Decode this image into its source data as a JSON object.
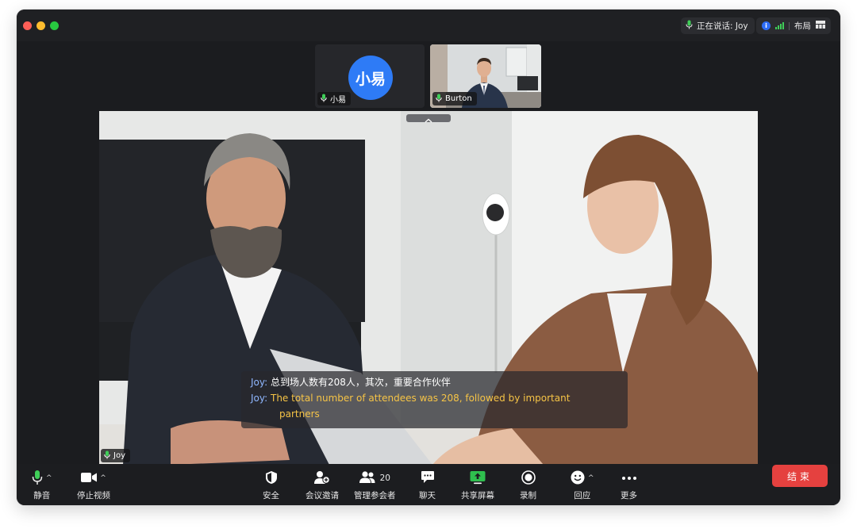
{
  "titlebar": {
    "speaking_status": "正在说话: Joy",
    "layout_label": "布局"
  },
  "thumbnails": [
    {
      "name": "小易",
      "avatar_text": "小易"
    },
    {
      "name": "Burton"
    }
  ],
  "main_video": {
    "speaker_name": "Joy"
  },
  "captions": {
    "speaker_zh": "Joy:",
    "text_zh": "总到场人数有208人，其次，重要合作伙伴",
    "speaker_en": "Joy:",
    "text_en_1": "The total number of attendees was 208, followed by important",
    "text_en_2": "partners"
  },
  "toolbar": {
    "mute": "静音",
    "stop_video": "停止视频",
    "security": "安全",
    "invite": "会议邀请",
    "participants": "管理参会者",
    "participants_count": "20",
    "chat": "聊天",
    "share_screen": "共享屏幕",
    "record": "录制",
    "reactions": "回应",
    "more": "更多",
    "end": "结束"
  },
  "colors": {
    "accent_blue": "#2e7bf6",
    "mic_green": "#3fce58",
    "share_green": "#2fbf4e",
    "end_red": "#e5413f",
    "caption_en": "#f6c446"
  },
  "icons": [
    "mic-icon",
    "video-camera-icon",
    "shield-icon",
    "add-user-icon",
    "participants-icon",
    "chat-icon",
    "share-screen-icon",
    "record-icon",
    "smile-icon",
    "more-icon",
    "info-icon",
    "signal-icon",
    "grid-layout-icon"
  ]
}
